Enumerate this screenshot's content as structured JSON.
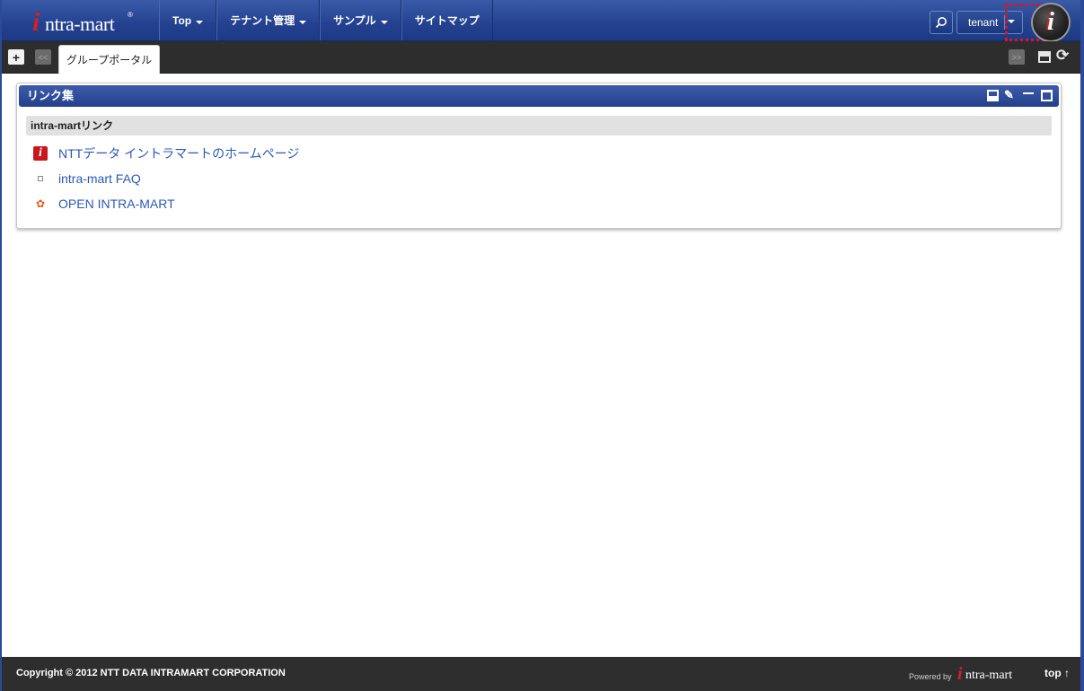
{
  "header": {
    "logo": {
      "mark": "i",
      "text": "ntra-mart",
      "reg": "®"
    },
    "nav": [
      {
        "label": "Top",
        "has_dropdown": true
      },
      {
        "label": "テナント管理",
        "has_dropdown": true
      },
      {
        "label": "サンプル",
        "has_dropdown": true
      },
      {
        "label": "サイトマップ",
        "has_dropdown": false
      }
    ],
    "search_icon": "search-icon",
    "tenant": "tenant",
    "user_icon": {
      "name": "intra-mart-user-icon",
      "mark": "i"
    }
  },
  "tabs": {
    "add": "+",
    "prev": "<<",
    "next": ">>",
    "active_tab": "グループポータル",
    "layout_icon": "layout-icon",
    "reload": "⟳"
  },
  "portlet": {
    "title": "リンク集",
    "section_title": "intra-martリンク",
    "links": [
      {
        "label": "NTTデータ イントラマートのホームページ",
        "icon": "intra-mart-icon"
      },
      {
        "label": "intra-mart FAQ",
        "icon": "page-icon"
      },
      {
        "label": "OPEN INTRA-MART",
        "icon": "open-intra-mart-icon"
      }
    ]
  },
  "footer": {
    "copyright": "Copyright © 2012 NTT DATA INTRAMART CORPORATION",
    "powered_by": "Powered by",
    "logo": {
      "mark": "i",
      "text": "ntra-mart",
      "reg": "®"
    },
    "top_link": "top ↑"
  },
  "colors": {
    "header_blue": "#23418f",
    "dark_bar": "#2d2d2d",
    "link_blue": "#2b58b8",
    "brand_red": "#d51f26"
  }
}
